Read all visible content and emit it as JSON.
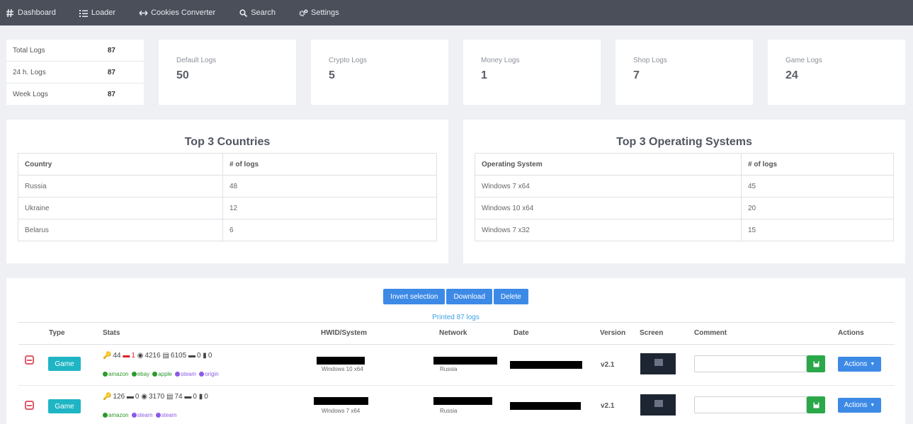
{
  "nav": [
    {
      "label": "Dashboard",
      "icon": "hash-icon"
    },
    {
      "label": "Loader",
      "icon": "list-icon"
    },
    {
      "label": "Cookies Converter",
      "icon": "arrows-icon"
    },
    {
      "label": "Search",
      "icon": "search-icon"
    },
    {
      "label": "Settings",
      "icon": "gears-icon"
    }
  ],
  "summary": [
    {
      "label": "Total Logs",
      "value": "87"
    },
    {
      "label": "24 h. Logs",
      "value": "87"
    },
    {
      "label": "Week Logs",
      "value": "87"
    }
  ],
  "stats": [
    {
      "label": "Default Logs",
      "value": "50"
    },
    {
      "label": "Crypto Logs",
      "value": "5"
    },
    {
      "label": "Money Logs",
      "value": "1"
    },
    {
      "label": "Shop Logs",
      "value": "7"
    },
    {
      "label": "Game Logs",
      "value": "24"
    }
  ],
  "countries": {
    "title": "Top 3 Countries",
    "headers": [
      "Country",
      "# of logs"
    ],
    "rows": [
      [
        "Russia",
        "48"
      ],
      [
        "Ukraine",
        "12"
      ],
      [
        "Belarus",
        "6"
      ]
    ]
  },
  "os": {
    "title": "Top 3 Operating Systems",
    "headers": [
      "Operating System",
      "# of logs"
    ],
    "rows": [
      [
        "Windows 7 x64",
        "45"
      ],
      [
        "Windows 10 x64",
        "20"
      ],
      [
        "Windows 7 x32",
        "15"
      ]
    ]
  },
  "logs": {
    "buttons": [
      "Invert selection",
      "Download",
      "Delete"
    ],
    "printed": "Printed 87 logs",
    "headers": [
      "Type",
      "Stats",
      "HWID/System",
      "Network",
      "Date",
      "Version",
      "Screen",
      "Comment",
      "Actions"
    ],
    "rows": [
      {
        "type": "Game",
        "stats": [
          "44",
          "1",
          "4216",
          "6105",
          "0",
          "0"
        ],
        "tags": [
          {
            "text": "amazon",
            "color": "green"
          },
          {
            "text": "ebay",
            "color": "green"
          },
          {
            "text": "apple",
            "color": "green"
          },
          {
            "text": "steam",
            "color": "purple"
          },
          {
            "text": "origin",
            "color": "purple"
          }
        ],
        "system": "Windows 10 x64",
        "network": "Russia",
        "version": "v2.1",
        "actions": "Actions"
      },
      {
        "type": "Game",
        "stats": [
          "126",
          "0",
          "3170",
          "74",
          "0",
          "0"
        ],
        "tags": [
          {
            "text": "amazon",
            "color": "green"
          },
          {
            "text": "steam",
            "color": "purple"
          },
          {
            "text": "steam",
            "color": "purple"
          }
        ],
        "system": "Windows 7 x64",
        "network": "Russia",
        "version": "v2.1",
        "actions": "Actions"
      }
    ]
  }
}
